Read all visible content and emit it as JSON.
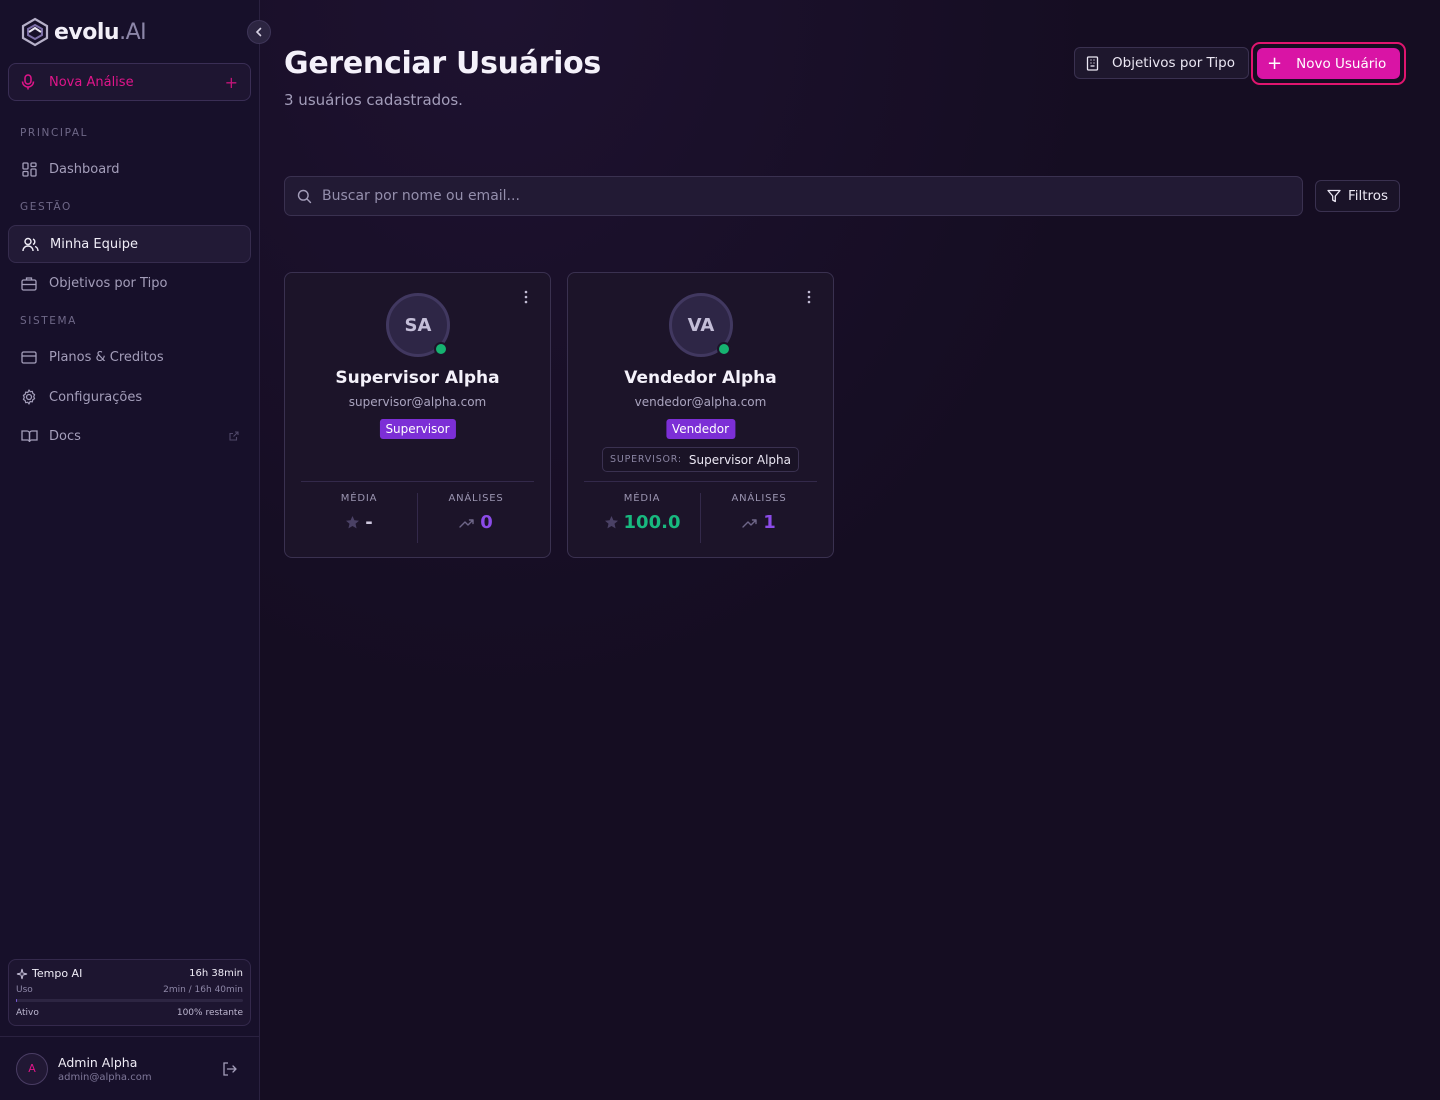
{
  "brand": {
    "name": "evolu",
    "suffix": ".AI"
  },
  "sidebar": {
    "new_analysis_label": "Nova Análise",
    "sections": {
      "principal": "PRINCIPAL",
      "gestao": "GESTÃO",
      "sistema": "SISTEMA"
    },
    "items": {
      "dashboard": "Dashboard",
      "team": "Minha Equipe",
      "objectives": "Objetivos por Tipo",
      "plans": "Planos & Creditos",
      "settings": "Configurações",
      "docs": "Docs"
    },
    "active_item": "Minha Equipe",
    "tempo": {
      "title": "Tempo AI",
      "total": "16h 38min",
      "usage_label": "Uso",
      "usage_value": "2min / 16h 40min",
      "usage_fraction": 0.002,
      "status": "Ativo",
      "remaining": "100% restante"
    },
    "user": {
      "initial": "A",
      "name": "Admin Alpha",
      "email": "admin@alpha.com"
    }
  },
  "header": {
    "title": "Gerenciar Usuários",
    "subtitle": "3 usuários cadastrados.",
    "objectives_button": "Objetivos por Tipo",
    "new_user_button": "Novo Usuário"
  },
  "search": {
    "placeholder": "Buscar por nome ou email...",
    "value": ""
  },
  "filters_button": "Filtros",
  "users": [
    {
      "initials": "SA",
      "name": "Supervisor Alpha",
      "email": "supervisor@alpha.com",
      "role": "Supervisor",
      "online": true,
      "stats": {
        "media_label": "MÉDIA",
        "media_value": "-",
        "analyses_label": "ANÁLISES",
        "analyses_value": "0"
      }
    },
    {
      "initials": "VA",
      "name": "Vendedor Alpha",
      "email": "vendedor@alpha.com",
      "role": "Vendedor",
      "online": true,
      "supervisor_label": "SUPERVISOR:",
      "supervisor_name": "Supervisor Alpha",
      "stats": {
        "media_label": "MÉDIA",
        "media_value": "100.0",
        "analyses_label": "ANÁLISES",
        "analyses_value": "1"
      }
    }
  ],
  "colors": {
    "accent": "#d914a5",
    "accent_border": "#e0156f",
    "role_badge": "#7c2fd6",
    "online": "#16b371",
    "score_green": "#18b97f",
    "analyses_purple": "#8b4be8",
    "background": "#150d22"
  }
}
